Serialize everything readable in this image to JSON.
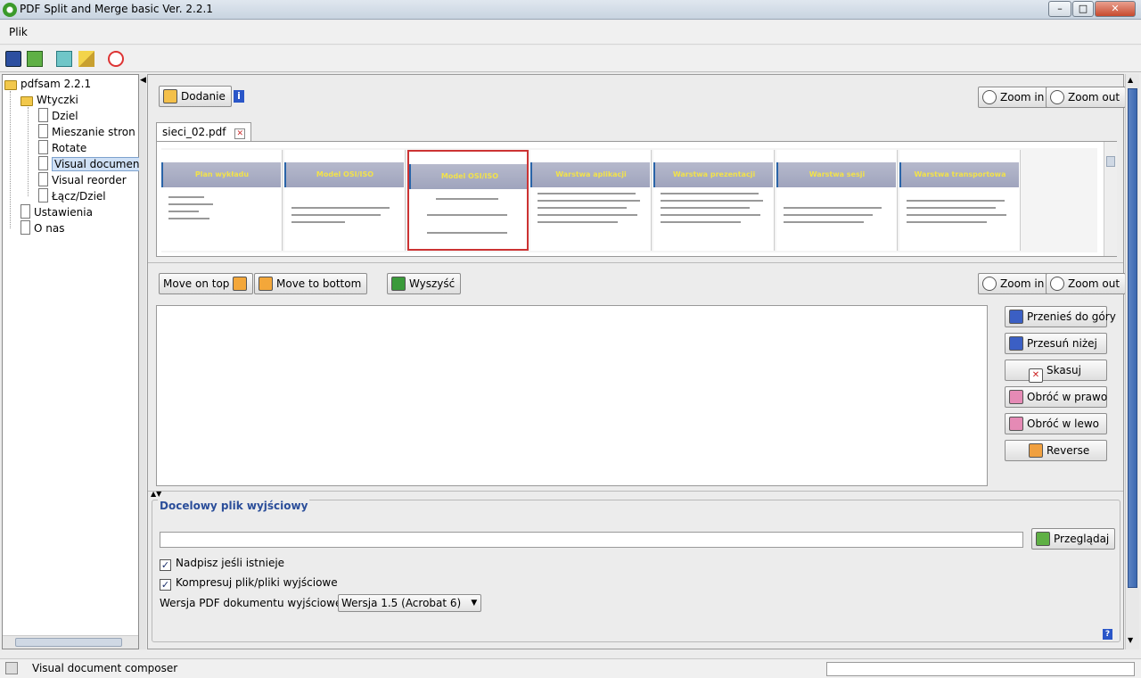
{
  "window": {
    "title": "PDF Split and Merge basic Ver. 2.2.1"
  },
  "menu": {
    "file": "Plik"
  },
  "tree": {
    "root": "pdfsam 2.2.1",
    "plugins": "Wtyczki",
    "items": [
      "Dziel",
      "Mieszanie stron",
      "Rotate",
      "Visual document",
      "Visual reorder",
      "Łącz/Dziel"
    ],
    "settings": "Ustawienia",
    "about": "O nas"
  },
  "top": {
    "add": "Dodanie",
    "zoom_in": "Zoom in",
    "zoom_out": "Zoom out",
    "tab": "sieci_02.pdf",
    "thumbs": [
      "Plan wykładu",
      "Model OSI/ISO",
      "Model OSI/ISO",
      "Warstwa aplikacji",
      "Warstwa prezentacji",
      "Warstwa sesji",
      "Warstwa transportowa"
    ]
  },
  "mid": {
    "move_top": "Move on top",
    "move_bottom": "Move to bottom",
    "clear": "Wyszyść",
    "zoom_in": "Zoom in",
    "zoom_out": "Zoom out",
    "side": [
      "Przenieś do góry",
      "Przesuń niżej",
      "Skasuj",
      "Obróć w prawo",
      "Obróć w lewo",
      "Reverse"
    ]
  },
  "output": {
    "legend": "Docelowy plik wyjściowy",
    "path": "",
    "browse": "Przeglądaj",
    "overwrite": "Nadpisz jeśli istnieje",
    "compress": "Kompresuj plik/pliki wyjściowe",
    "version_label": "Wersja PDF dokumentu wyjściowego:",
    "version": "Wersja 1.5 (Acrobat 6)",
    "help": "?"
  },
  "status": {
    "text": "Visual document composer"
  }
}
